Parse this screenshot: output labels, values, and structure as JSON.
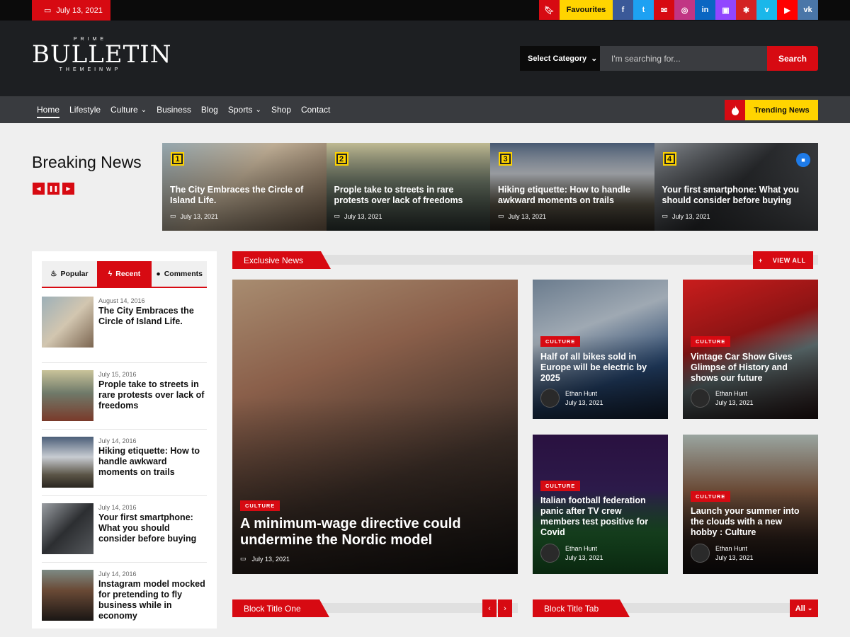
{
  "topbar": {
    "date": "July 13, 2021",
    "favourites_label": "Favourites",
    "social": [
      {
        "icon": "facebook-icon",
        "glyph": "f",
        "color": "#3b5998"
      },
      {
        "icon": "twitter-icon",
        "glyph": "t",
        "color": "#1da1f2"
      },
      {
        "icon": "email-icon",
        "glyph": "✉",
        "color": "#d70a12"
      },
      {
        "icon": "instagram-icon",
        "glyph": "◎",
        "color": "#c13584"
      },
      {
        "icon": "linkedin-icon",
        "glyph": "in",
        "color": "#0a66c2"
      },
      {
        "icon": "twitch-icon",
        "glyph": "▣",
        "color": "#9146ff"
      },
      {
        "icon": "yelp-icon",
        "glyph": "✱",
        "color": "#d32323"
      },
      {
        "icon": "vimeo-icon",
        "glyph": "v",
        "color": "#1ab7ea"
      },
      {
        "icon": "youtube-icon",
        "glyph": "▶",
        "color": "#ff0000"
      },
      {
        "icon": "vk-icon",
        "glyph": "vk",
        "color": "#4a76a8"
      }
    ]
  },
  "header": {
    "logo_top": "PRIME",
    "logo_main": "BULLETIN",
    "logo_bottom": "THEMEINWP",
    "category_label": "Select Category",
    "search_placeholder": "I'm searching for...",
    "search_button": "Search"
  },
  "nav": {
    "items": [
      "Home",
      "Lifestyle",
      "Culture",
      "Business",
      "Blog",
      "Sports",
      "Shop",
      "Contact"
    ],
    "trending_label": "Trending News"
  },
  "breaking": {
    "title": "Breaking News",
    "cards": [
      {
        "num": "1",
        "title": "The City Embraces the Circle of Island Life.",
        "date": "July 13, 2021"
      },
      {
        "num": "2",
        "title": "Prople take to streets in rare protests over lack of freedoms",
        "date": "July 13, 2021"
      },
      {
        "num": "3",
        "title": "Hiking etiquette: How to handle awkward moments on trails",
        "date": "July 13, 2021"
      },
      {
        "num": "4",
        "title": "Your first smartphone: What you should consider before buying",
        "date": "July 13, 2021"
      }
    ]
  },
  "sidebar": {
    "tabs": [
      "Popular",
      "Recent",
      "Comments"
    ],
    "items": [
      {
        "date": "August 14, 2016",
        "title": "The City Embraces the Circle of Island Life."
      },
      {
        "date": "July 15, 2016",
        "title": "Prople take to streets in rare protests over lack of freedoms"
      },
      {
        "date": "July 14, 2016",
        "title": "Hiking etiquette: How to handle awkward moments on trails"
      },
      {
        "date": "July 14, 2016",
        "title": "Your first smartphone: What you should consider before buying"
      },
      {
        "date": "July 14, 2016",
        "title": "Instagram model mocked for pretending to fly business while in economy"
      }
    ]
  },
  "exclusive": {
    "title": "Exclusive News",
    "view_all": "VIEW ALL",
    "main": {
      "tag": "CULTURE",
      "title": "A minimum-wage directive could undermine the Nordic model",
      "date": "July 13, 2021"
    },
    "cards": [
      {
        "tag": "CULTURE",
        "title": "Half of all bikes sold in Europe will be electric by 2025",
        "author": "Ethan Hunt",
        "date": "July 13, 2021"
      },
      {
        "tag": "CULTURE",
        "title": "Vintage Car Show Gives Glimpse of History and shows our future",
        "author": "Ethan Hunt",
        "date": "July 13, 2021"
      },
      {
        "tag": "CULTURE",
        "title": "Italian football federation panic after TV crew members test positive for Covid",
        "author": "Ethan Hunt",
        "date": "July 13, 2021"
      },
      {
        "tag": "CULTURE",
        "title": "Launch your summer into the clouds with a new hobby : Culture",
        "author": "Ethan Hunt",
        "date": "July 13, 2021"
      }
    ]
  },
  "blocks": {
    "one_title": "Block Title One",
    "tab_title": "Block Title Tab",
    "all_label": "All"
  },
  "colors": {
    "accent": "#d70a12",
    "highlight": "#ffd400",
    "header_bg": "#1d1f22",
    "nav_bg": "#393b3f"
  }
}
